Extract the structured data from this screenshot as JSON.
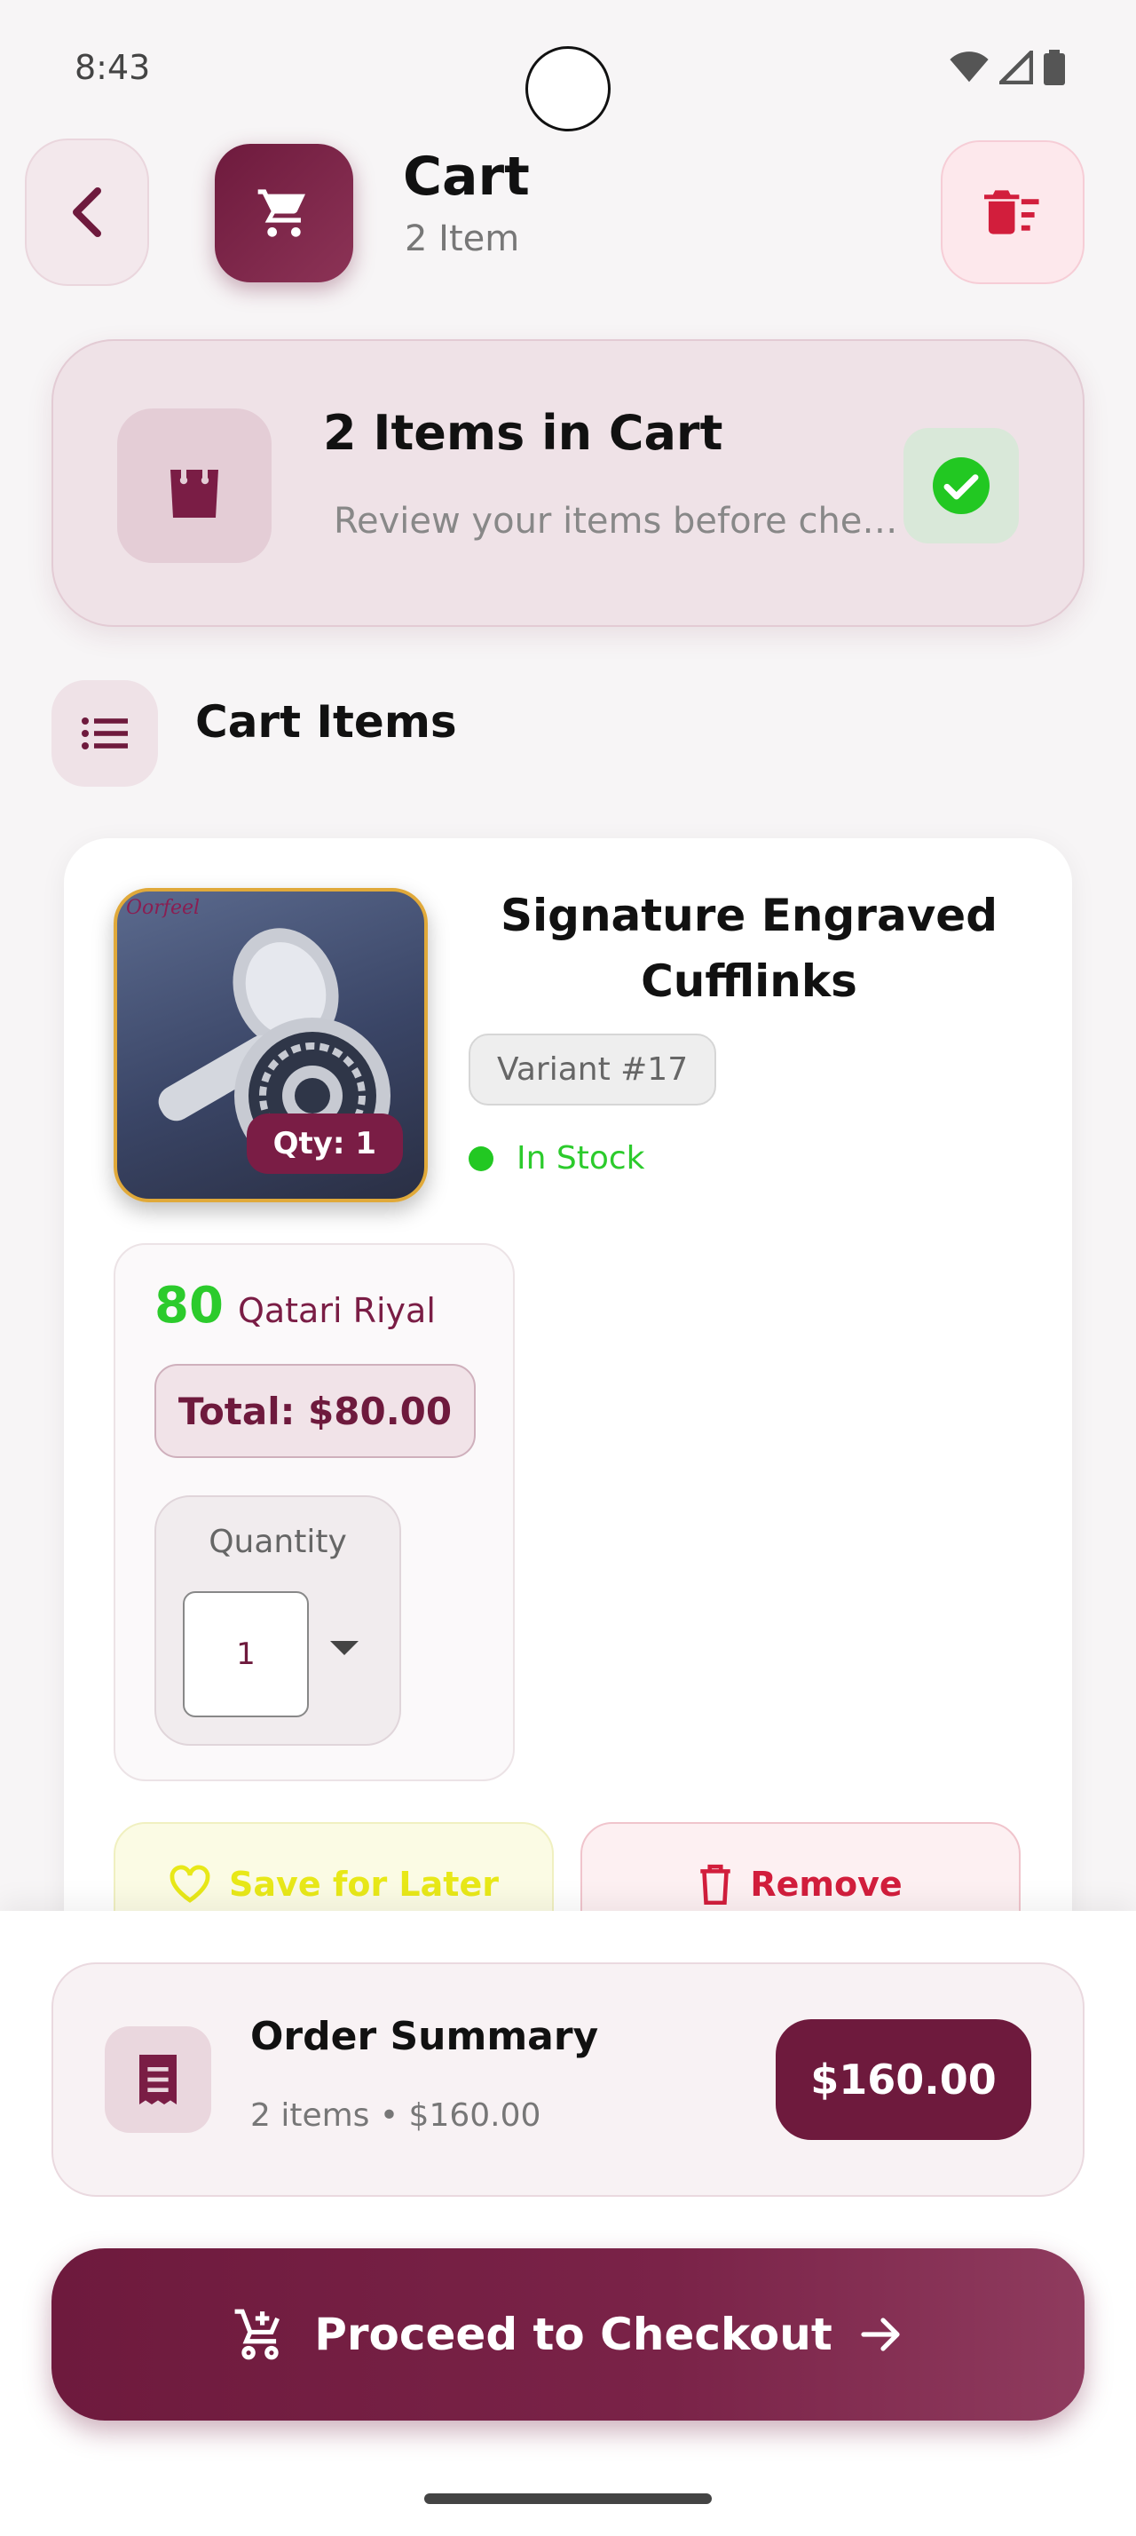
{
  "status_bar": {
    "time": "8:43"
  },
  "header": {
    "title": "Cart",
    "subtitle": "2 Item"
  },
  "banner": {
    "title": "2 Items in Cart",
    "subtitle": "Review your items before checkout"
  },
  "section": {
    "title": "Cart Items"
  },
  "item": {
    "image_brand": "Oorfeel",
    "qty_badge": "Qty: 1",
    "name": "Signature Engraved Cufflinks",
    "variant": "Variant #17",
    "stock": "In Stock",
    "price": "80",
    "currency": "Qatari Riyal",
    "total": "Total: $80.00",
    "quantity_label": "Quantity",
    "quantity_value": "1",
    "save_label": "Save for Later",
    "remove_label": "Remove"
  },
  "summary": {
    "title": "Order Summary",
    "subtitle": "2 items • $160.00",
    "total": "$160.00"
  },
  "checkout": {
    "label": "Proceed to Checkout"
  },
  "colors": {
    "brand": "#6e1a3d",
    "success": "#2ccb2c",
    "danger": "#d21e3c",
    "warning": "#e8e818"
  }
}
